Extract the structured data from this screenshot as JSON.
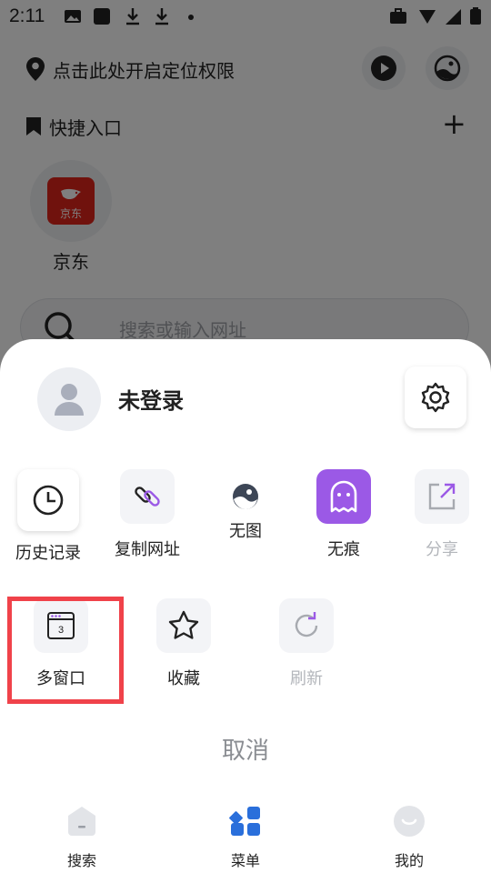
{
  "status_bar": {
    "time": "2:11"
  },
  "background": {
    "location_text": "点击此处开启定位权限",
    "quick_entry_title": "快捷入口",
    "add_symbol": "+",
    "sites": [
      {
        "name": "京东",
        "logo_text": "京东",
        "icon": "jd-logo-icon"
      }
    ],
    "search_placeholder": "搜索或输入网址"
  },
  "sheet": {
    "login_text": "未登录",
    "row1": [
      {
        "label": "历史记录",
        "icon": "clock-icon",
        "enabled": true
      },
      {
        "label": "复制网址",
        "icon": "link-icon",
        "enabled": true
      },
      {
        "label": "无图",
        "icon": "no-image-icon",
        "enabled": true
      },
      {
        "label": "无痕",
        "icon": "ghost-icon",
        "enabled": true,
        "active": true
      },
      {
        "label": "分享",
        "icon": "share-icon",
        "enabled": false
      }
    ],
    "row2": [
      {
        "label": "多窗口",
        "icon": "window-icon",
        "badge": "3",
        "enabled": true
      },
      {
        "label": "收藏",
        "icon": "star-icon",
        "enabled": true
      },
      {
        "label": "刷新",
        "icon": "refresh-icon",
        "enabled": false
      }
    ],
    "cancel_label": "取消"
  },
  "bottom_nav": [
    {
      "label": "搜索",
      "icon": "home-icon"
    },
    {
      "label": "菜单",
      "icon": "menu-grid-icon"
    },
    {
      "label": "我的",
      "icon": "profile-face-icon"
    }
  ],
  "colors": {
    "accent_purple": "#9b59e6",
    "accent_blue": "#2a6fdb",
    "highlight_red": "#f0424a",
    "jd_red": "#e1251b"
  }
}
